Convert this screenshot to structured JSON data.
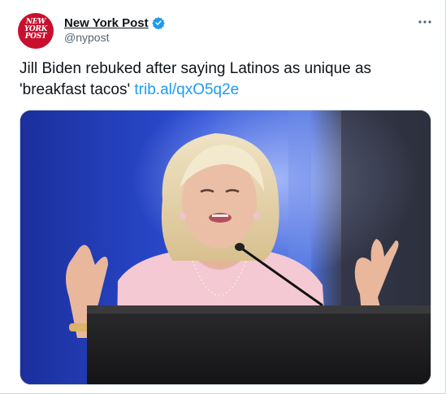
{
  "account": {
    "avatar_text": "NEW\nYORK\nPOST",
    "display_name": "New York Post",
    "handle": "@nypost",
    "verified": true
  },
  "tweet": {
    "text": "Jill Biden rebuked after saying Latinos as unique as 'breakfast tacos'",
    "link": "trib.al/qxO5q2e"
  },
  "colors": {
    "brand_red": "#c8102e",
    "link_blue": "#1d9bf0",
    "verified_blue": "#1d9bf0"
  },
  "icons": {
    "more": "more-horizontal-icon",
    "verified": "verified-badge-icon"
  }
}
